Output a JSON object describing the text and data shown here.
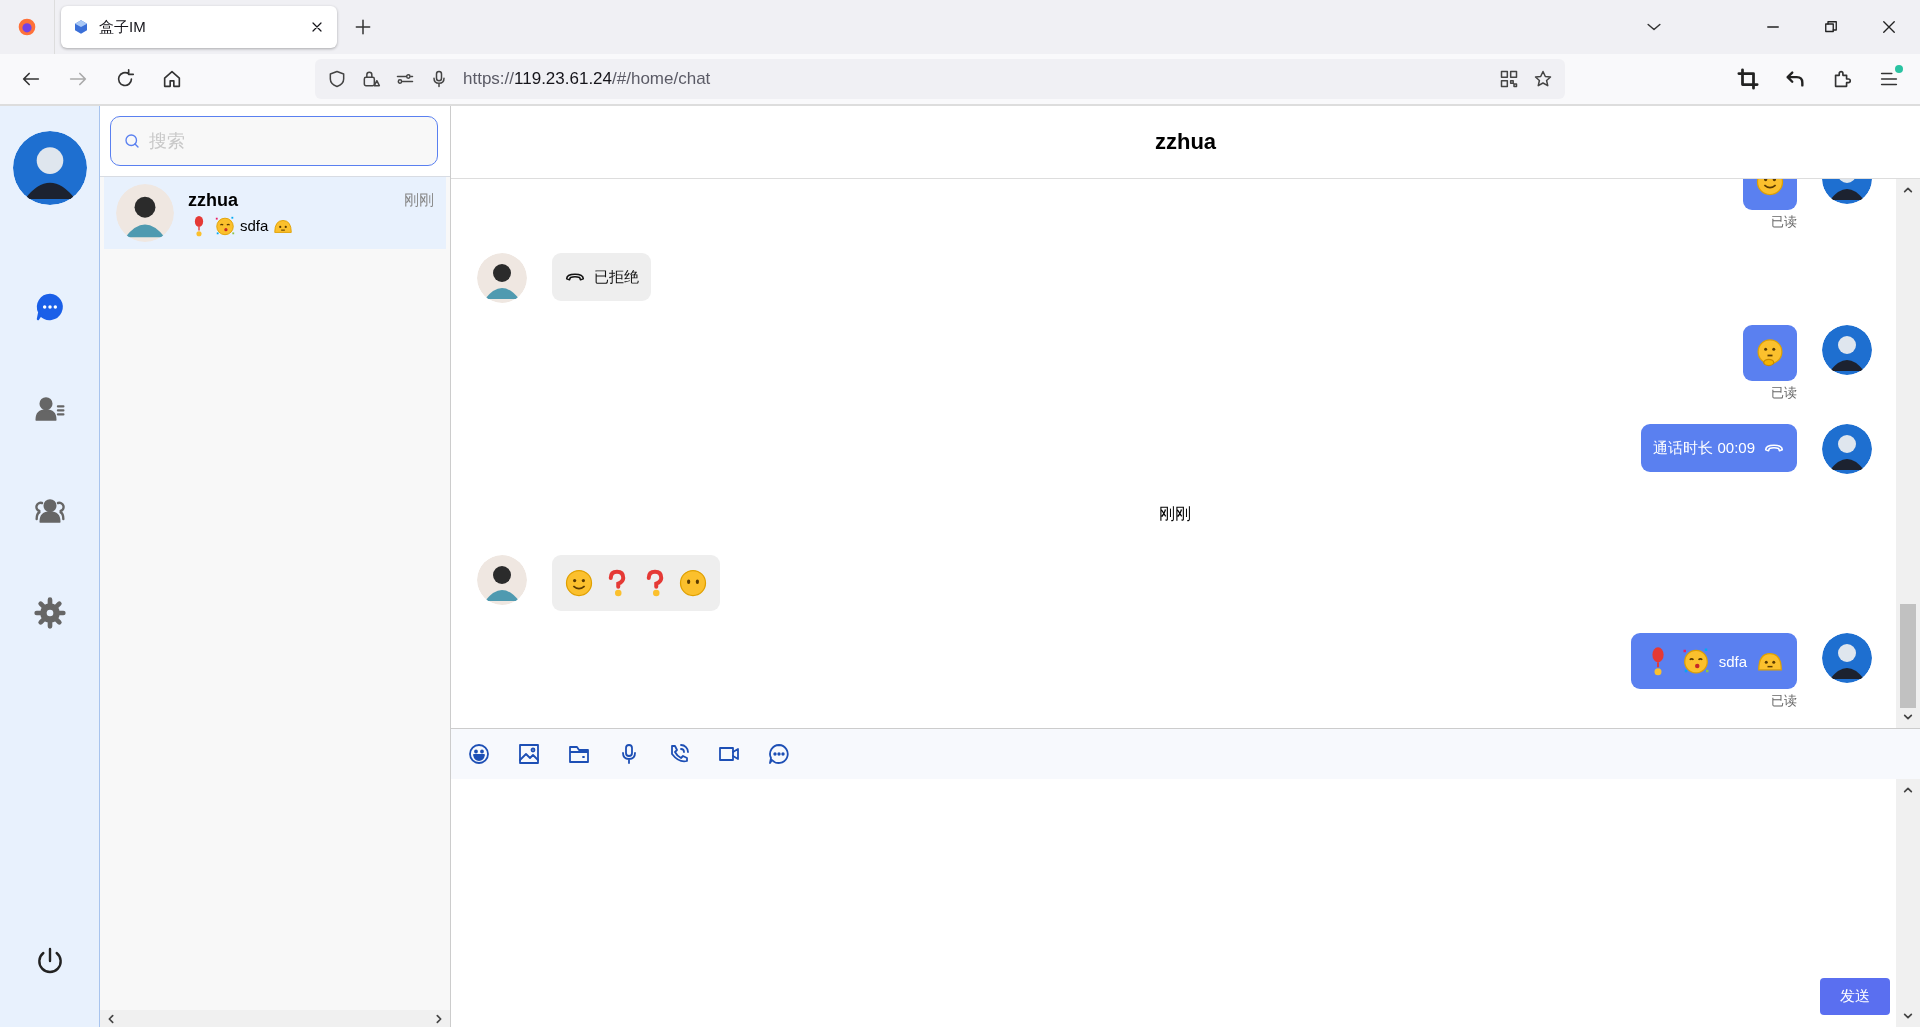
{
  "browser": {
    "tab": {
      "title": "盒子IM"
    },
    "address": {
      "scheme": "https://",
      "host": "119.23.61.24",
      "path": "/#/home/chat"
    }
  },
  "nav": {
    "items": [
      {
        "kind": "chat",
        "selected": true
      },
      {
        "kind": "contacts",
        "selected": false
      },
      {
        "kind": "groups",
        "selected": false
      },
      {
        "kind": "settings",
        "selected": false
      }
    ]
  },
  "search": {
    "placeholder": "搜索"
  },
  "conversations": [
    {
      "name": "zzhua",
      "time": "刚刚",
      "selected": true,
      "preview": [
        {
          "kind": "balloon"
        },
        {
          "kind": "party"
        },
        {
          "kind": "text",
          "text": "sdfa"
        },
        {
          "kind": "melting"
        }
      ]
    }
  ],
  "chat": {
    "title": "zzhua",
    "messages": [
      {
        "kind": "outgoing",
        "parts": [
          {
            "kind": "smile"
          }
        ],
        "receipt": "已读"
      },
      {
        "kind": "incoming",
        "parts": [
          {
            "kind": "hangup"
          },
          {
            "kind": "text",
            "text": "已拒绝"
          }
        ]
      },
      {
        "kind": "outgoing",
        "parts": [
          {
            "kind": "thinking"
          }
        ],
        "receipt": "已读"
      },
      {
        "kind": "outgoing",
        "parts": [
          {
            "kind": "text",
            "text": "通话时长 00:09"
          },
          {
            "kind": "hangup"
          }
        ]
      },
      {
        "kind": "time",
        "text": "刚刚"
      },
      {
        "kind": "incoming",
        "parts": [
          {
            "kind": "smile"
          },
          {
            "kind": "question"
          },
          {
            "kind": "question"
          },
          {
            "kind": "neutral"
          }
        ]
      },
      {
        "kind": "outgoing",
        "parts": [
          {
            "kind": "balloon"
          },
          {
            "kind": "party"
          },
          {
            "kind": "text",
            "text": "sdfa"
          },
          {
            "kind": "melting"
          }
        ],
        "receipt": "已读"
      }
    ],
    "send_button": "发送"
  }
}
